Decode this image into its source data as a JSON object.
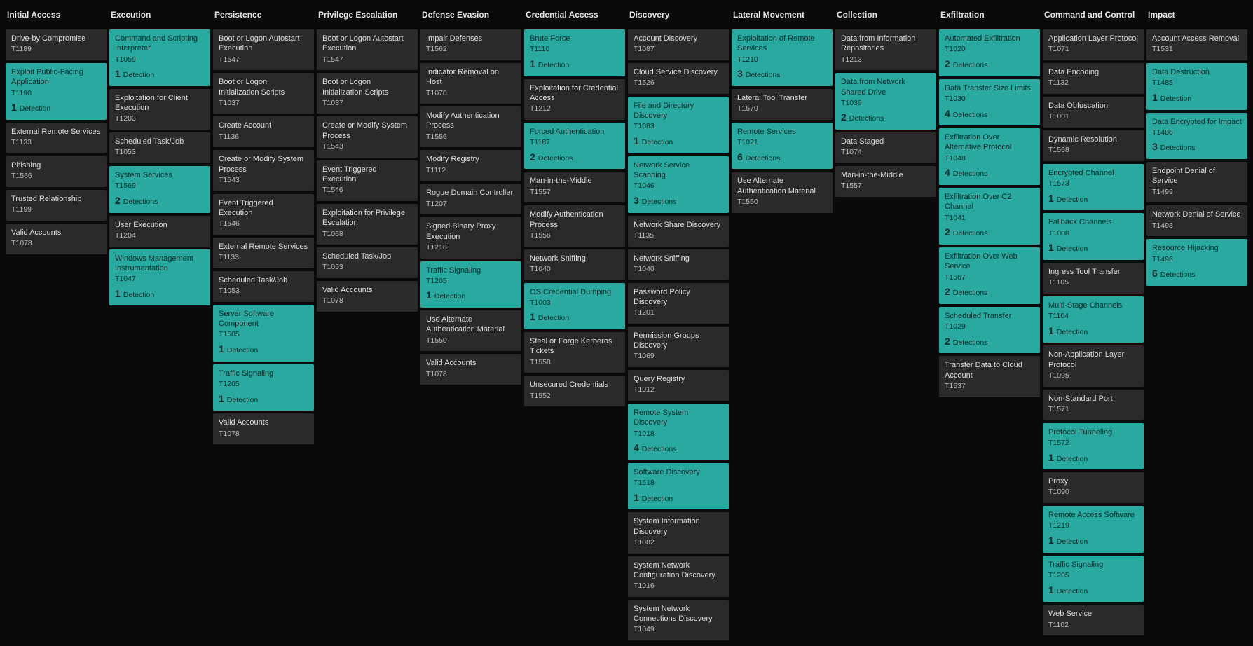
{
  "tactics": [
    {
      "name": "Initial Access",
      "techniques": [
        {
          "name": "Drive-by Compromise",
          "id": "T1189"
        },
        {
          "name": "Exploit Public-Facing Application",
          "id": "T1190",
          "detections": 1,
          "hl": true
        },
        {
          "name": "External Remote Services",
          "id": "T1133"
        },
        {
          "name": "Phishing",
          "id": "T1566"
        },
        {
          "name": "Trusted Relationship",
          "id": "T1199"
        },
        {
          "name": "Valid Accounts",
          "id": "T1078"
        }
      ]
    },
    {
      "name": "Execution",
      "techniques": [
        {
          "name": "Command and Scripting Interpreter",
          "id": "T1059",
          "detections": 1,
          "hl": true
        },
        {
          "name": "Exploitation for Client Execution",
          "id": "T1203"
        },
        {
          "name": "Scheduled Task/Job",
          "id": "T1053"
        },
        {
          "name": "System Services",
          "id": "T1569",
          "detections": 2,
          "hl": true
        },
        {
          "name": "User Execution",
          "id": "T1204"
        },
        {
          "name": "Windows Management Instrumentation",
          "id": "T1047",
          "detections": 1,
          "hl": true
        }
      ]
    },
    {
      "name": "Persistence",
      "techniques": [
        {
          "name": "Boot or Logon Autostart Execution",
          "id": "T1547"
        },
        {
          "name": "Boot or Logon Initialization Scripts",
          "id": "T1037"
        },
        {
          "name": "Create Account",
          "id": "T1136"
        },
        {
          "name": "Create or Modify System Process",
          "id": "T1543"
        },
        {
          "name": "Event Triggered Execution",
          "id": "T1546"
        },
        {
          "name": "External Remote Services",
          "id": "T1133"
        },
        {
          "name": "Scheduled Task/Job",
          "id": "T1053"
        },
        {
          "name": "Server Software Component",
          "id": "T1505",
          "detections": 1,
          "hl": true
        },
        {
          "name": "Traffic Signaling",
          "id": "T1205",
          "detections": 1,
          "hl": true
        },
        {
          "name": "Valid Accounts",
          "id": "T1078"
        }
      ]
    },
    {
      "name": "Privilege Escalation",
      "techniques": [
        {
          "name": "Boot or Logon Autostart Execution",
          "id": "T1547"
        },
        {
          "name": "Boot or Logon Initialization Scripts",
          "id": "T1037"
        },
        {
          "name": "Create or Modify System Process",
          "id": "T1543"
        },
        {
          "name": "Event Triggered Execution",
          "id": "T1546"
        },
        {
          "name": "Exploitation for Privilege Escalation",
          "id": "T1068"
        },
        {
          "name": "Scheduled Task/Job",
          "id": "T1053"
        },
        {
          "name": "Valid Accounts",
          "id": "T1078"
        }
      ]
    },
    {
      "name": "Defense Evasion",
      "techniques": [
        {
          "name": "Impair Defenses",
          "id": "T1562"
        },
        {
          "name": "Indicator Removal on Host",
          "id": "T1070"
        },
        {
          "name": "Modify Authentication Process",
          "id": "T1556"
        },
        {
          "name": "Modify Registry",
          "id": "T1112"
        },
        {
          "name": "Rogue Domain Controller",
          "id": "T1207"
        },
        {
          "name": "Signed Binary Proxy Execution",
          "id": "T1218"
        },
        {
          "name": "Traffic Signaling",
          "id": "T1205",
          "detections": 1,
          "hl": true
        },
        {
          "name": "Use Alternate Authentication Material",
          "id": "T1550"
        },
        {
          "name": "Valid Accounts",
          "id": "T1078"
        }
      ]
    },
    {
      "name": "Credential Access",
      "techniques": [
        {
          "name": "Brute Force",
          "id": "T1110",
          "detections": 1,
          "hl": true
        },
        {
          "name": "Exploitation for Credential Access",
          "id": "T1212"
        },
        {
          "name": "Forced Authentication",
          "id": "T1187",
          "detections": 2,
          "hl": true
        },
        {
          "name": "Man-in-the-Middle",
          "id": "T1557"
        },
        {
          "name": "Modify Authentication Process",
          "id": "T1556"
        },
        {
          "name": "Network Sniffing",
          "id": "T1040"
        },
        {
          "name": "OS Credential Dumping",
          "id": "T1003",
          "detections": 1,
          "hl": true
        },
        {
          "name": "Steal or Forge Kerberos Tickets",
          "id": "T1558"
        },
        {
          "name": "Unsecured Credentials",
          "id": "T1552"
        }
      ]
    },
    {
      "name": "Discovery",
      "techniques": [
        {
          "name": "Account Discovery",
          "id": "T1087"
        },
        {
          "name": "Cloud Service Discovery",
          "id": "T1526"
        },
        {
          "name": "File and Directory Discovery",
          "id": "T1083",
          "detections": 1,
          "hl": true
        },
        {
          "name": "Network Service Scanning",
          "id": "T1046",
          "detections": 3,
          "hl": true
        },
        {
          "name": "Network Share Discovery",
          "id": "T1135"
        },
        {
          "name": "Network Sniffing",
          "id": "T1040"
        },
        {
          "name": "Password Policy Discovery",
          "id": "T1201"
        },
        {
          "name": "Permission Groups Discovery",
          "id": "T1069"
        },
        {
          "name": "Query Registry",
          "id": "T1012"
        },
        {
          "name": "Remote System Discovery",
          "id": "T1018",
          "detections": 4,
          "hl": true
        },
        {
          "name": "Software Discovery",
          "id": "T1518",
          "detections": 1,
          "hl": true
        },
        {
          "name": "System Information Discovery",
          "id": "T1082"
        },
        {
          "name": "System Network Configuration Discovery",
          "id": "T1016"
        },
        {
          "name": "System Network Connections Discovery",
          "id": "T1049"
        }
      ]
    },
    {
      "name": "Lateral Movement",
      "techniques": [
        {
          "name": "Exploitation of Remote Services",
          "id": "T1210",
          "detections": 3,
          "hl": true
        },
        {
          "name": "Lateral Tool Transfer",
          "id": "T1570"
        },
        {
          "name": "Remote Services",
          "id": "T1021",
          "detections": 6,
          "hl": true
        },
        {
          "name": "Use Alternate Authentication Material",
          "id": "T1550"
        }
      ]
    },
    {
      "name": "Collection",
      "techniques": [
        {
          "name": "Data from Information Repositories",
          "id": "T1213"
        },
        {
          "name": "Data from Network Shared Drive",
          "id": "T1039",
          "detections": 2,
          "hl": true
        },
        {
          "name": "Data Staged",
          "id": "T1074"
        },
        {
          "name": "Man-in-the-Middle",
          "id": "T1557"
        }
      ]
    },
    {
      "name": "Exfiltration",
      "techniques": [
        {
          "name": "Automated Exfiltration",
          "id": "T1020",
          "detections": 2,
          "hl": true
        },
        {
          "name": "Data Transfer Size Limits",
          "id": "T1030",
          "detections": 4,
          "hl": true
        },
        {
          "name": "Exfiltration Over Alternative Protocol",
          "id": "T1048",
          "detections": 4,
          "hl": true
        },
        {
          "name": "Exfiltration Over C2 Channel",
          "id": "T1041",
          "detections": 2,
          "hl": true
        },
        {
          "name": "Exfiltration Over Web Service",
          "id": "T1567",
          "detections": 2,
          "hl": true
        },
        {
          "name": "Scheduled Transfer",
          "id": "T1029",
          "detections": 2,
          "hl": true
        },
        {
          "name": "Transfer Data to Cloud Account",
          "id": "T1537"
        }
      ]
    },
    {
      "name": "Command and Control",
      "techniques": [
        {
          "name": "Application Layer Protocol",
          "id": "T1071"
        },
        {
          "name": "Data Encoding",
          "id": "T1132"
        },
        {
          "name": "Data Obfuscation",
          "id": "T1001"
        },
        {
          "name": "Dynamic Resolution",
          "id": "T1568"
        },
        {
          "name": "Encrypted Channel",
          "id": "T1573",
          "detections": 1,
          "hl": true
        },
        {
          "name": "Fallback Channels",
          "id": "T1008",
          "detections": 1,
          "hl": true
        },
        {
          "name": "Ingress Tool Transfer",
          "id": "T1105"
        },
        {
          "name": "Multi-Stage Channels",
          "id": "T1104",
          "detections": 1,
          "hl": true
        },
        {
          "name": "Non-Application Layer Protocol",
          "id": "T1095"
        },
        {
          "name": "Non-Standard Port",
          "id": "T1571"
        },
        {
          "name": "Protocol Tunneling",
          "id": "T1572",
          "detections": 1,
          "hl": true
        },
        {
          "name": "Proxy",
          "id": "T1090"
        },
        {
          "name": "Remote Access Software",
          "id": "T1219",
          "detections": 1,
          "hl": true
        },
        {
          "name": "Traffic Signaling",
          "id": "T1205",
          "detections": 1,
          "hl": true
        },
        {
          "name": "Web Service",
          "id": "T1102"
        }
      ]
    },
    {
      "name": "Impact",
      "techniques": [
        {
          "name": "Account Access Removal",
          "id": "T1531"
        },
        {
          "name": "Data Destruction",
          "id": "T1485",
          "detections": 1,
          "hl": true
        },
        {
          "name": "Data Encrypted for Impact",
          "id": "T1486",
          "detections": 3,
          "hl": true
        },
        {
          "name": "Endpoint Denial of Service",
          "id": "T1499"
        },
        {
          "name": "Network Denial of Service",
          "id": "T1498"
        },
        {
          "name": "Resource Hijacking",
          "id": "T1496",
          "detections": 6,
          "hl": true
        }
      ]
    }
  ],
  "labels": {
    "detection_singular": "Detection",
    "detection_plural": "Detections"
  }
}
